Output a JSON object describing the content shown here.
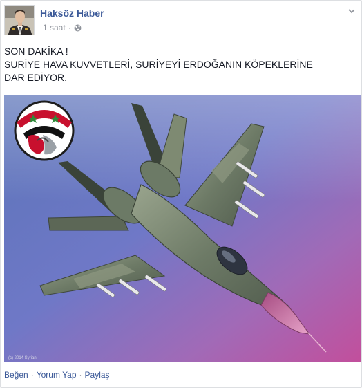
{
  "post": {
    "author": "Haksöz Haber",
    "time": "1 saat",
    "separator": "·",
    "text_lines": [
      "SON DAKİKA !",
      "SURİYE HAVA KUVVETLERİ, SURİYEYİ ERDOĞANIN KÖPEKLERİNE",
      "DAR EDİYOR."
    ],
    "image_watermark": "(c) 2014 Syrian"
  },
  "actions": {
    "like": "Beğen",
    "comment": "Yorum Yap",
    "share": "Paylaş",
    "separator": "·"
  },
  "colors": {
    "link": "#3b5998",
    "meta": "#90949c",
    "text": "#141823"
  }
}
